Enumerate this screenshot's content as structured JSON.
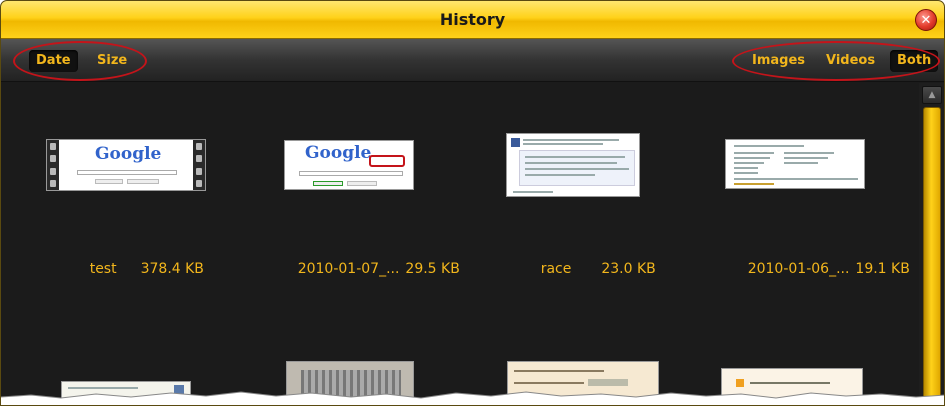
{
  "window": {
    "title": "History"
  },
  "toolbar": {
    "sort": [
      {
        "label": "Date",
        "active": true
      },
      {
        "label": "Size",
        "active": false
      }
    ],
    "filter": [
      {
        "label": "Images",
        "active": false
      },
      {
        "label": "Videos",
        "active": false
      },
      {
        "label": "Both",
        "active": true
      }
    ]
  },
  "items": [
    {
      "name": "test",
      "size": "378.4 KB",
      "kind": "video"
    },
    {
      "name": "2010-01-07_...",
      "size": "29.5 KB",
      "kind": "image"
    },
    {
      "name": "race",
      "size": "23.0 KB",
      "kind": "image"
    },
    {
      "name": "2010-01-06_...",
      "size": "19.1 KB",
      "kind": "image"
    }
  ],
  "thumb_text": {
    "google": "Google"
  },
  "colors": {
    "accent": "#f2b61c",
    "annotation": "#c4141a",
    "titlebar": "#ffd21a",
    "background": "#1b1b1b"
  }
}
